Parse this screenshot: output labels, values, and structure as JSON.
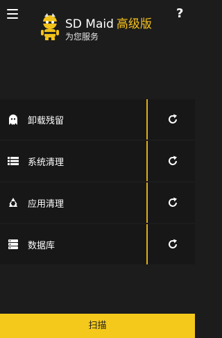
{
  "header": {
    "app_name": "SD Maid",
    "edition": "高级版",
    "subtitle": "为您服务",
    "help_symbol": "?",
    "menu_icon": "hamburger-icon",
    "logo_icon": "sd-maid-robot-logo"
  },
  "tools": [
    {
      "label": "卸载残留",
      "icon": "ghost-icon"
    },
    {
      "label": "系统清理",
      "icon": "list-icon"
    },
    {
      "label": "应用清理",
      "icon": "recycle-icon"
    },
    {
      "label": "数据库",
      "icon": "database-icon"
    }
  ],
  "refresh_icon": "refresh-icon",
  "scan_button": {
    "label": "扫描"
  },
  "colors": {
    "background": "#1c1c1c",
    "row": "#171717",
    "accent": "#f5c91b",
    "divider": "#e0ae18"
  }
}
